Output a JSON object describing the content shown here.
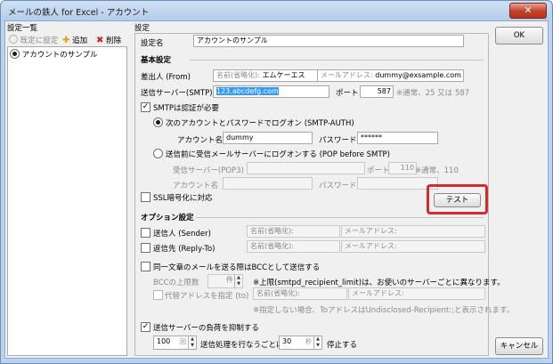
{
  "window": {
    "title": "メールの鉄人 for Excel - アカウント",
    "close_glyph": "✕"
  },
  "left_panel": {
    "header": "設定一覧",
    "toolbar": {
      "default_label": "既定に設定",
      "add_label": "追加",
      "delete_label": "削除"
    },
    "accounts": [
      "アカウントのサンプル"
    ]
  },
  "settings": {
    "header": "設定",
    "name_label": "設定名",
    "name_value": "アカウントのサンプル",
    "basic_section": "基本設定",
    "sender_label": "差出人 (From)",
    "sender_name_placeholder": "名前(省略化):",
    "sender_name_value": "エムケーエス",
    "sender_mail_placeholder": "メールアドレス:",
    "sender_mail_value": "dummy@exsample.com",
    "smtp_label": "送信サーバー(SMTP)",
    "smtp_value": "123.abcdefg.com",
    "port_label": "ポート",
    "port_value": "587",
    "port_note": "※通常、25 又は 587",
    "smtp_auth_label": "SMTPは認証が必要",
    "smtp_auth_checked": true,
    "auth_radio1_label": "次のアカウントとパスワードでログオン (SMTP-AUTH)",
    "account_label": "アカウント名",
    "account_value": "dummy",
    "password_label": "パスワード",
    "password_value": "******",
    "auth_radio2_label": "送信前に受信メールサーバーにログオンする (POP before SMTP)",
    "pop_label": "受信サーバー(POP3)",
    "pop_port_label": "ポート",
    "pop_port_value": "110",
    "pop_port_note": "※通常、110",
    "pop_account_label": "アカウント名",
    "pop_password_label": "パスワード",
    "ssl_label": "SSL暗号化に対応",
    "test_button": "テスト",
    "highlight_color": "#d52b2b",
    "option_section": "オプション設定",
    "option_sender_label": "送信人 (Sender)",
    "option_sender_name_placeholder": "名前(省略化):",
    "option_sender_mail_placeholder": "メールアドレス:",
    "reply_label": "返信先 (Reply-To)",
    "reply_name_placeholder": "名前(省略化):",
    "reply_mail_placeholder": "メールアドレス:",
    "bcc_label": "同一文章のメールを送る際はBCCとして送信する",
    "bcc_limit_label": "BCCの上限数",
    "bcc_unit": "件",
    "bcc_note": "※上限(smtpd_recipient_limit)は、お使いのサーバーごとに異なります。",
    "proxy_label": "代替アドレスを指定 (to)",
    "proxy_name_placeholder": "名前(省略化):",
    "proxy_mail_placeholder": "メールアドレス:",
    "proxy_note": "※指定しない場合、ToアドレスはUndisclosed-Recipient:;と表示されます。",
    "throttle_label": "送信サーバーの負荷を抑制する",
    "throttle_checked": true,
    "throttle_count": "100",
    "throttle_count_unit": "回",
    "throttle_mid": "送信処理を行なうごとに",
    "throttle_seconds": "30",
    "throttle_seconds_unit": "秒",
    "throttle_end": "停止する"
  },
  "buttons": {
    "ok": "OK",
    "cancel": "キャンセル"
  }
}
